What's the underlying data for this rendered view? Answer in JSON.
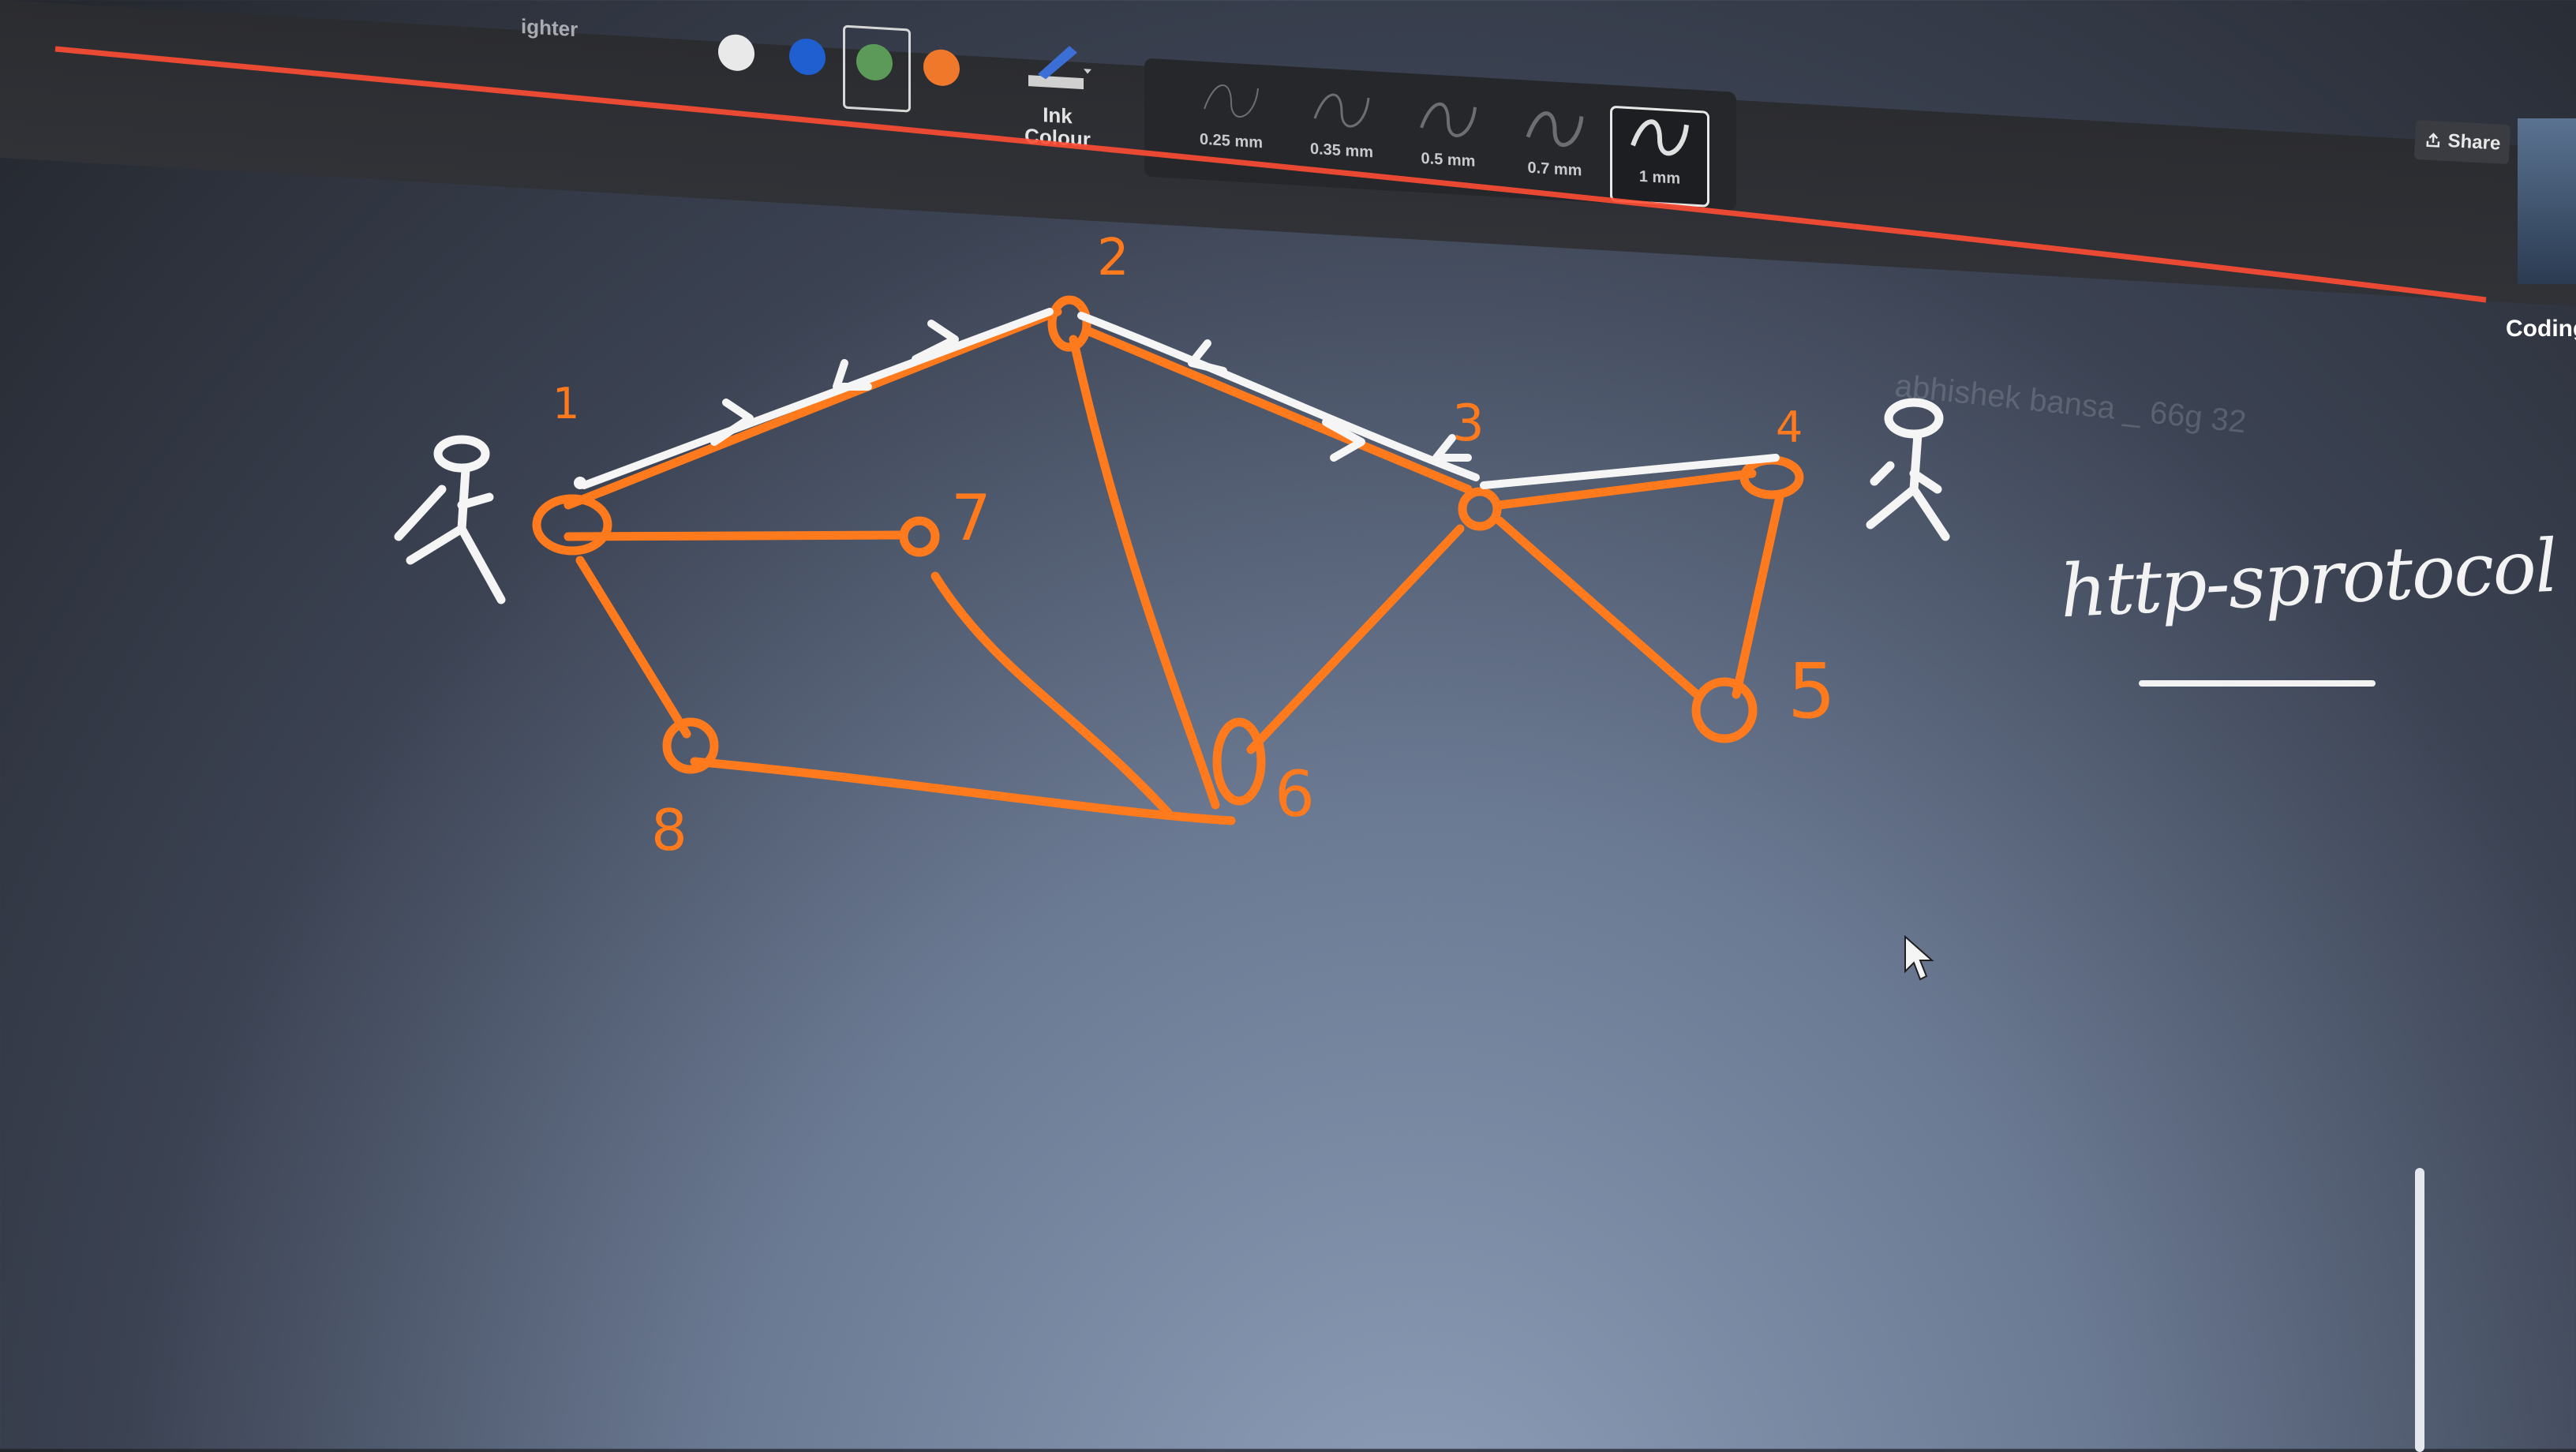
{
  "toolbar": {
    "highlighter_label": "ighter",
    "ink_colour_label_line1": "Ink",
    "ink_colour_label_line2": "Colour",
    "swatches": [
      {
        "name": "white",
        "color": "#e9e9e9"
      },
      {
        "name": "blue",
        "color": "#1f5fd0"
      },
      {
        "name": "green",
        "color": "#5c9a59"
      },
      {
        "name": "orange",
        "color": "#f0782b"
      }
    ],
    "thickness_options": [
      "0.25 mm",
      "0.35 mm",
      "0.5 mm",
      "0.7 mm",
      "1 mm"
    ],
    "selected_thickness": "1 mm",
    "share_label": "Share"
  },
  "side_panel": {
    "label": "Coding"
  },
  "canvas": {
    "watermark": "abhishek bansa _ 66g 32",
    "handwritten_text": "http-sprotocol",
    "node_labels": [
      "1",
      "2",
      "3",
      "4",
      "5",
      "6",
      "7",
      "8"
    ],
    "ink_colors": {
      "orange": "#ff7a1c",
      "white": "#f5f5f5",
      "red_line": "#ff4c33"
    }
  }
}
